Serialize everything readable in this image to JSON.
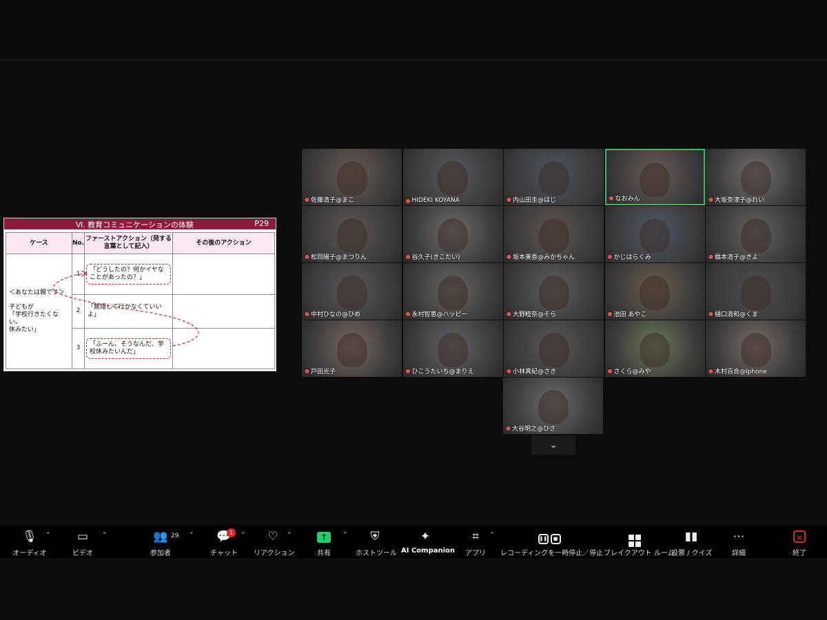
{
  "slide": {
    "title": "Ⅵ. 教育コミュニケーションの体験",
    "page": "P29",
    "headers": [
      "ケース",
      "No.",
      "ファーストアクション（発する言葉として記入）",
      "その後のアクション"
    ],
    "case_lines": [
      "＜あなたは親です＞",
      "子どもが",
      "「学校行きたくない。",
      "休みたい」"
    ],
    "rows": [
      {
        "no": "1",
        "first": "「どうしたの？何かイヤなことがあったの？」",
        "after": ""
      },
      {
        "no": "2",
        "first": "「無理して行かなくていいよ」",
        "after": ""
      },
      {
        "no": "3",
        "first": "「ふーん、そうなんだ、学校休みたいんだ」",
        "after": ""
      }
    ]
  },
  "participants": [
    {
      "name": "佐藤清子@まこ",
      "bg": "#6b5b52"
    },
    {
      "name": "HIDEKI KOYANA",
      "bg": "#555a5e"
    },
    {
      "name": "内山田圭@はじ",
      "bg": "#4c5660"
    },
    {
      "name": "なおみん",
      "bg": "#6a5d57"
    },
    {
      "name": "大坂奈津子@れい",
      "bg": "#777070"
    },
    {
      "name": "松岡陽子@まつりん",
      "bg": "#5d5654"
    },
    {
      "name": "谷久子(きこたい)",
      "bg": "#6e6e70"
    },
    {
      "name": "坂本美香@みかちゃん",
      "bg": "#5e5550"
    },
    {
      "name": "かじはらくみ",
      "bg": "#505a66"
    },
    {
      "name": "橋本清子@きよ",
      "bg": "#636060"
    },
    {
      "name": "中村ひなの@ひめ",
      "bg": "#55585c"
    },
    {
      "name": "永村智恵@ハッピー",
      "bg": "#6a6560"
    },
    {
      "name": "大野睦奈@そら",
      "bg": "#5c5f61"
    },
    {
      "name": "池田 あやこ",
      "bg": "#6b5d4f"
    },
    {
      "name": "樋口清和@くま",
      "bg": "#4e4e52"
    },
    {
      "name": "戸田光子",
      "bg": "#7a6a62"
    },
    {
      "name": "ひこうたいち@まりえ",
      "bg": "#606468"
    },
    {
      "name": "小林真紀@さき",
      "bg": "#595656"
    },
    {
      "name": "さくら@みや",
      "bg": "#6c7a56"
    },
    {
      "name": "木村百合@Iphone",
      "bg": "#7a6d66"
    },
    {
      "name": "大谷明之@ひさ",
      "bg": "#6a6c70"
    }
  ],
  "toolbar": {
    "audio": "オーディオ",
    "video": "ビデオ",
    "participants": "参加者",
    "participant_count": "29",
    "chat": "チャット",
    "chat_badge": "1",
    "reactions": "リアクション",
    "share": "共有",
    "host_tools": "ホストツール",
    "ai_companion": "AI Companion",
    "apps": "アプリ",
    "recording": "レコーディングを一時停止／停止",
    "breakout": "ブレイクアウト ルーム",
    "polls": "投票 / クイズ",
    "more": "詳細",
    "end": "終了"
  },
  "colors": {
    "slide_header": "#8e1a3c",
    "share_green": "#1fcf6b",
    "end_red": "#e02828",
    "active_speaker": "#29c26b"
  }
}
